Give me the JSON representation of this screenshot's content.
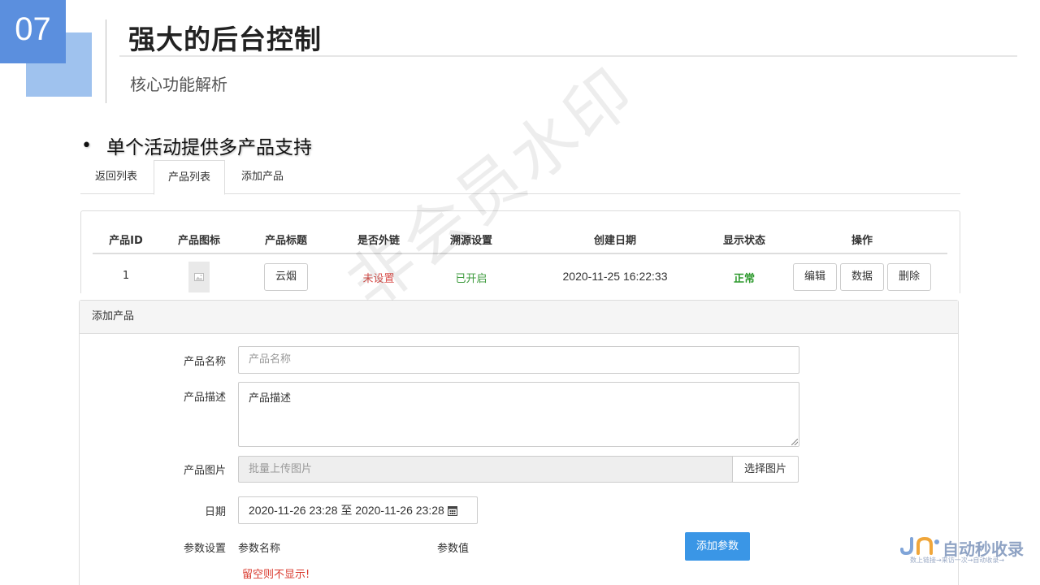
{
  "slide": {
    "number": "07",
    "title": "强大的后台控制",
    "subtitle": "核心功能解析",
    "bullet": "单个活动提供多产品支持"
  },
  "tabs": [
    {
      "label": "返回列表",
      "active": false
    },
    {
      "label": "产品列表",
      "active": true
    },
    {
      "label": "添加产品",
      "active": false
    }
  ],
  "table": {
    "headers": [
      "产品ID",
      "产品图标",
      "产品标题",
      "是否外链",
      "溯源设置",
      "创建日期",
      "显示状态",
      "操作"
    ],
    "row": {
      "id": "1",
      "icon": "image-placeholder-icon",
      "title": "云烟",
      "external_link": "未设置",
      "trace": "已开启",
      "created": "2020-11-25 16:22:33",
      "status": "正常",
      "actions": [
        "编辑",
        "数据",
        "删除"
      ]
    },
    "colors": {
      "external_link": "#d9534f",
      "trace": "#3c9a3c",
      "status": "#2e9a2e"
    }
  },
  "add_panel": {
    "heading": "添加产品",
    "name_label": "产品名称",
    "name_placeholder": "产品名称",
    "desc_label": "产品描述",
    "desc_value": "产品描述",
    "image_label": "产品图片",
    "image_placeholder": "批量上传图片",
    "image_button": "选择图片",
    "date_label": "日期",
    "date_value": "2020-11-26 23:28 至 2020-11-26 23:28",
    "date_icon": "calendar-icon",
    "param_label": "参数设置",
    "param_name_label": "参数名称",
    "param_value_label": "参数值",
    "add_param_button": "添加参数",
    "hint": "留空则不显示!",
    "hint_color": "#d9382c",
    "accent": "#3a96e6"
  },
  "watermark": "非会员水印",
  "logo": {
    "text": "自动秒收录",
    "slogan": "数上链接→来访一次→自动收录→"
  }
}
